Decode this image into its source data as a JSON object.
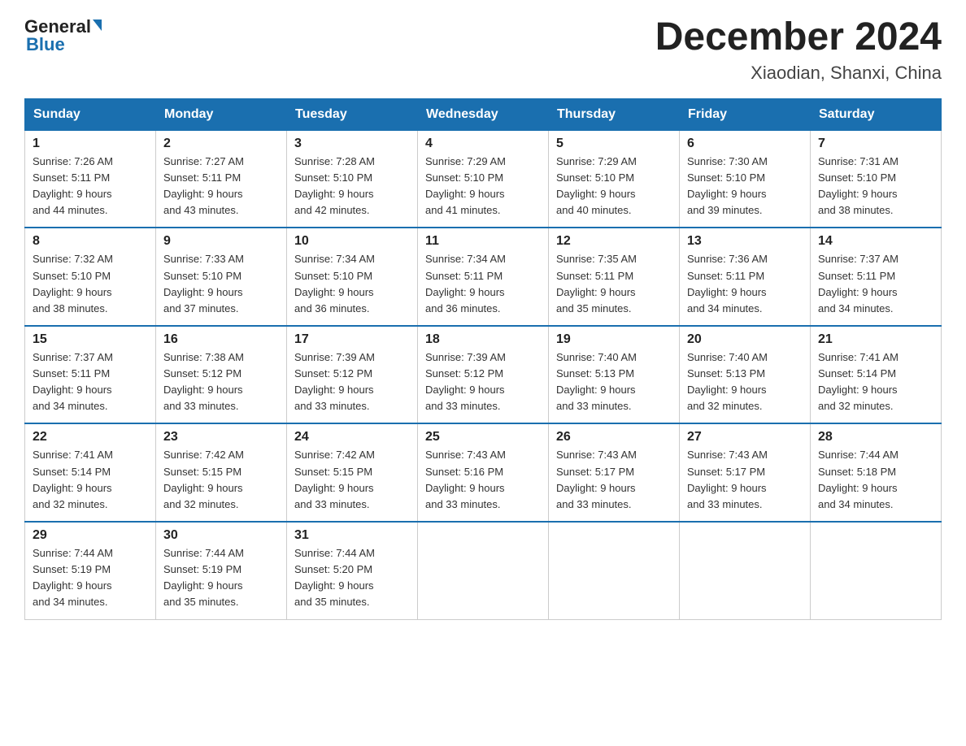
{
  "header": {
    "logo_general": "General",
    "logo_blue": "Blue",
    "month_title": "December 2024",
    "location": "Xiaodian, Shanxi, China"
  },
  "days_of_week": [
    "Sunday",
    "Monday",
    "Tuesday",
    "Wednesday",
    "Thursday",
    "Friday",
    "Saturday"
  ],
  "weeks": [
    [
      {
        "day": "1",
        "sunrise": "7:26 AM",
        "sunset": "5:11 PM",
        "daylight": "9 hours and 44 minutes."
      },
      {
        "day": "2",
        "sunrise": "7:27 AM",
        "sunset": "5:11 PM",
        "daylight": "9 hours and 43 minutes."
      },
      {
        "day": "3",
        "sunrise": "7:28 AM",
        "sunset": "5:10 PM",
        "daylight": "9 hours and 42 minutes."
      },
      {
        "day": "4",
        "sunrise": "7:29 AM",
        "sunset": "5:10 PM",
        "daylight": "9 hours and 41 minutes."
      },
      {
        "day": "5",
        "sunrise": "7:29 AM",
        "sunset": "5:10 PM",
        "daylight": "9 hours and 40 minutes."
      },
      {
        "day": "6",
        "sunrise": "7:30 AM",
        "sunset": "5:10 PM",
        "daylight": "9 hours and 39 minutes."
      },
      {
        "day": "7",
        "sunrise": "7:31 AM",
        "sunset": "5:10 PM",
        "daylight": "9 hours and 38 minutes."
      }
    ],
    [
      {
        "day": "8",
        "sunrise": "7:32 AM",
        "sunset": "5:10 PM",
        "daylight": "9 hours and 38 minutes."
      },
      {
        "day": "9",
        "sunrise": "7:33 AM",
        "sunset": "5:10 PM",
        "daylight": "9 hours and 37 minutes."
      },
      {
        "day": "10",
        "sunrise": "7:34 AM",
        "sunset": "5:10 PM",
        "daylight": "9 hours and 36 minutes."
      },
      {
        "day": "11",
        "sunrise": "7:34 AM",
        "sunset": "5:11 PM",
        "daylight": "9 hours and 36 minutes."
      },
      {
        "day": "12",
        "sunrise": "7:35 AM",
        "sunset": "5:11 PM",
        "daylight": "9 hours and 35 minutes."
      },
      {
        "day": "13",
        "sunrise": "7:36 AM",
        "sunset": "5:11 PM",
        "daylight": "9 hours and 34 minutes."
      },
      {
        "day": "14",
        "sunrise": "7:37 AM",
        "sunset": "5:11 PM",
        "daylight": "9 hours and 34 minutes."
      }
    ],
    [
      {
        "day": "15",
        "sunrise": "7:37 AM",
        "sunset": "5:11 PM",
        "daylight": "9 hours and 34 minutes."
      },
      {
        "day": "16",
        "sunrise": "7:38 AM",
        "sunset": "5:12 PM",
        "daylight": "9 hours and 33 minutes."
      },
      {
        "day": "17",
        "sunrise": "7:39 AM",
        "sunset": "5:12 PM",
        "daylight": "9 hours and 33 minutes."
      },
      {
        "day": "18",
        "sunrise": "7:39 AM",
        "sunset": "5:12 PM",
        "daylight": "9 hours and 33 minutes."
      },
      {
        "day": "19",
        "sunrise": "7:40 AM",
        "sunset": "5:13 PM",
        "daylight": "9 hours and 33 minutes."
      },
      {
        "day": "20",
        "sunrise": "7:40 AM",
        "sunset": "5:13 PM",
        "daylight": "9 hours and 32 minutes."
      },
      {
        "day": "21",
        "sunrise": "7:41 AM",
        "sunset": "5:14 PM",
        "daylight": "9 hours and 32 minutes."
      }
    ],
    [
      {
        "day": "22",
        "sunrise": "7:41 AM",
        "sunset": "5:14 PM",
        "daylight": "9 hours and 32 minutes."
      },
      {
        "day": "23",
        "sunrise": "7:42 AM",
        "sunset": "5:15 PM",
        "daylight": "9 hours and 32 minutes."
      },
      {
        "day": "24",
        "sunrise": "7:42 AM",
        "sunset": "5:15 PM",
        "daylight": "9 hours and 33 minutes."
      },
      {
        "day": "25",
        "sunrise": "7:43 AM",
        "sunset": "5:16 PM",
        "daylight": "9 hours and 33 minutes."
      },
      {
        "day": "26",
        "sunrise": "7:43 AM",
        "sunset": "5:17 PM",
        "daylight": "9 hours and 33 minutes."
      },
      {
        "day": "27",
        "sunrise": "7:43 AM",
        "sunset": "5:17 PM",
        "daylight": "9 hours and 33 minutes."
      },
      {
        "day": "28",
        "sunrise": "7:44 AM",
        "sunset": "5:18 PM",
        "daylight": "9 hours and 34 minutes."
      }
    ],
    [
      {
        "day": "29",
        "sunrise": "7:44 AM",
        "sunset": "5:19 PM",
        "daylight": "9 hours and 34 minutes."
      },
      {
        "day": "30",
        "sunrise": "7:44 AM",
        "sunset": "5:19 PM",
        "daylight": "9 hours and 35 minutes."
      },
      {
        "day": "31",
        "sunrise": "7:44 AM",
        "sunset": "5:20 PM",
        "daylight": "9 hours and 35 minutes."
      },
      null,
      null,
      null,
      null
    ]
  ],
  "labels": {
    "sunrise": "Sunrise:",
    "sunset": "Sunset:",
    "daylight": "Daylight:"
  }
}
